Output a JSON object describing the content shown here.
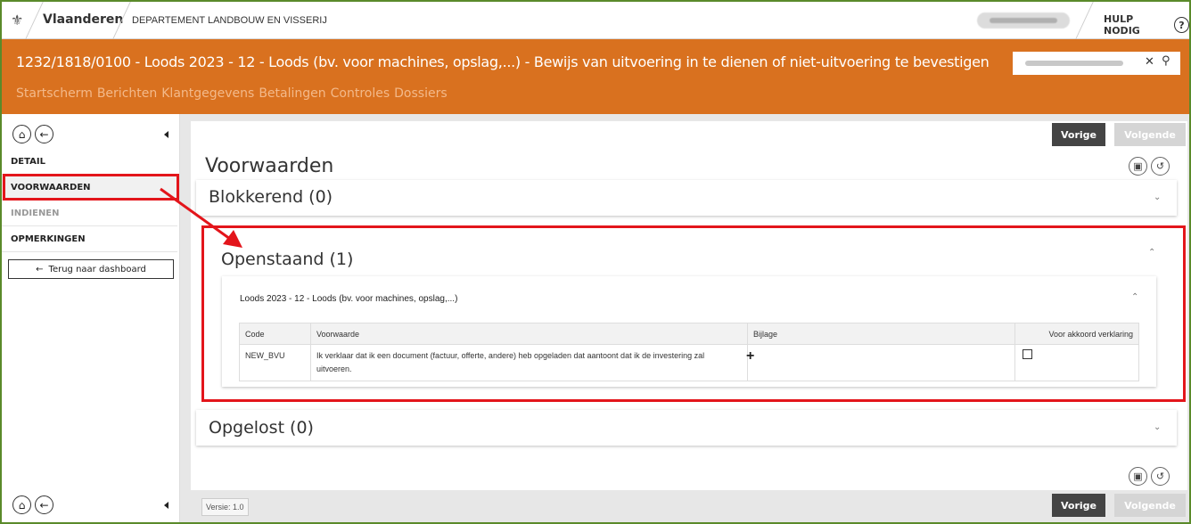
{
  "topbar": {
    "brand": "Vlaanderen",
    "department": "DEPARTEMENT LANDBOUW EN VISSERIJ",
    "help_label": "HULP NODIG",
    "help_icon": "?"
  },
  "header": {
    "dossier_title": "1232/1818/0100 - Loods 2023 - 12 - Loods (bv. voor machines, opslag,...) - Bewijs van uitvoering in te dienen of niet-uitvoering te bevestigen",
    "nav": [
      "Startscherm",
      "Berichten",
      "Klantgegevens",
      "Betalingen",
      "Controles",
      "Dossiers"
    ]
  },
  "sidebar": {
    "items": [
      {
        "label": "DETAIL"
      },
      {
        "label": "VOORWAARDEN"
      },
      {
        "label": "INDIENEN"
      },
      {
        "label": "OPMERKINGEN"
      }
    ],
    "back_label": "Terug naar dashboard"
  },
  "toolbar": {
    "prev_label": "Vorige",
    "next_label": "Volgende"
  },
  "main": {
    "title": "Voorwaarden",
    "sections": {
      "blokkerend": "Blokkerend (0)",
      "openstaand": "Openstaand (1)",
      "opgelost": "Opgelost (0)"
    },
    "open_item": {
      "title": "Loods 2023 - 12 - Loods (bv. voor machines, opslag,...)",
      "columns": [
        "Code",
        "Voorwaarde",
        "Bijlage",
        "Voor akkoord verklaring"
      ],
      "rows": [
        {
          "code": "NEW_BVU",
          "voorwaarde": "Ik verklaar dat ik een document (factuur, offerte, andere) heb opgeladen dat aantoont dat ik de investering zal uitvoeren.",
          "bijlage": "+"
        }
      ]
    },
    "version": "Versie: 1.0"
  },
  "colors": {
    "brand_orange": "#d9711f",
    "annotation_red": "#e3151b",
    "frame_green": "#5a8a2a"
  }
}
